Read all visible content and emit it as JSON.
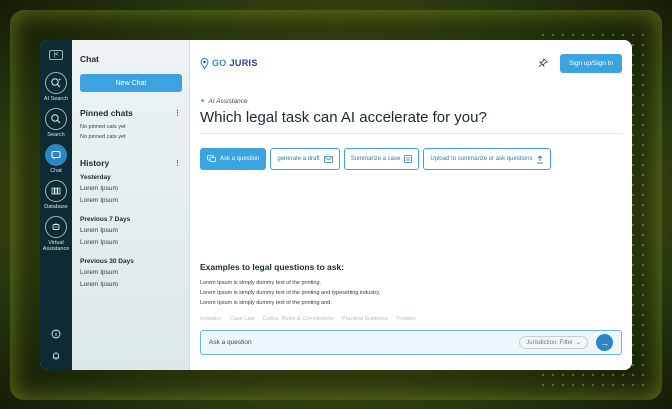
{
  "rail": {
    "items": [
      {
        "label": "AI Search",
        "icon": "ai-search-icon"
      },
      {
        "label": "Search",
        "icon": "search-icon"
      },
      {
        "label": "Chat",
        "icon": "chat-icon",
        "active": true
      },
      {
        "label": "Database",
        "icon": "database-icon"
      },
      {
        "label": "Virtual Assistance",
        "icon": "virtual-assistance-icon"
      }
    ]
  },
  "sidebar": {
    "title": "Chat",
    "new_chat": "New Chat",
    "pinned_title": "Pinned chats",
    "pinned_empty": [
      "No pinned cats yet",
      "No pinned cats yet"
    ],
    "history_title": "History",
    "groups": [
      {
        "label": "Yesterday",
        "items": [
          "Lorem Ipsum",
          "Lorem Ipsum"
        ]
      },
      {
        "label": "Previous 7 Days",
        "items": [
          "Lorem Ipsum",
          "Lorem Ipsum"
        ]
      },
      {
        "label": "Previous 30 Days",
        "items": [
          "Lorem Ipsum",
          "Lorem Ipsum"
        ]
      }
    ]
  },
  "header": {
    "logo_go": "GO",
    "logo_juris": "JURIS",
    "signup": "Sign up/Sign In"
  },
  "main": {
    "ai_tag": "AI Assistance",
    "headline": "Which legal task can AI accelerate for you?",
    "tasks": [
      "Ask a question",
      "generate a draft",
      "Summarize a case",
      "Upload to summarize or ask questions"
    ],
    "examples_title": "Examples to legal questions to ask:",
    "examples": [
      "Lorem Ipsum is simply dummy text of the printing.",
      "Lorem Ipsum is simply dummy text of the printing and typesetting industry.",
      "Lorem Ipsum is simply dummy text of the printing and."
    ],
    "includes_label": "Includes:",
    "includes": [
      "Case Law",
      "Codes, Rules & Constitutions",
      "Practical Guidance",
      "Treaties"
    ],
    "ask_placeholder": "Ask a question",
    "jurisdiction": "Jurisdiction: Filter"
  },
  "colors": {
    "accent": "#3aa3e0",
    "rail": "#0e2a33"
  }
}
